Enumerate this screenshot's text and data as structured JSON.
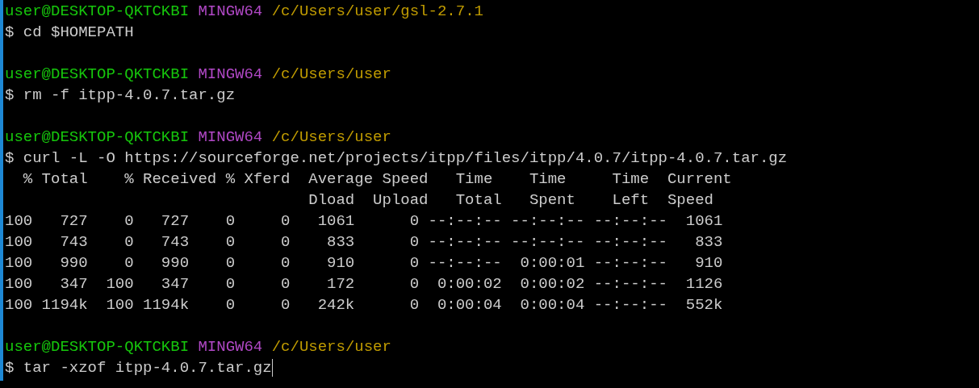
{
  "lines": [
    {
      "kind": "prompt",
      "user_host": "user@DESKTOP-QKTCKBI",
      "shell": "MINGW64",
      "path": "/c/Users/user/gsl-2.7.1"
    },
    {
      "kind": "command",
      "text": "$ cd $HOMEPATH",
      "cursor": false
    },
    {
      "kind": "blank"
    },
    {
      "kind": "prompt",
      "user_host": "user@DESKTOP-QKTCKBI",
      "shell": "MINGW64",
      "path": "/c/Users/user"
    },
    {
      "kind": "command",
      "text": "$ rm -f itpp-4.0.7.tar.gz",
      "cursor": false
    },
    {
      "kind": "blank"
    },
    {
      "kind": "prompt",
      "user_host": "user@DESKTOP-QKTCKBI",
      "shell": "MINGW64",
      "path": "/c/Users/user"
    },
    {
      "kind": "command",
      "text": "$ curl -L -O https://sourceforge.net/projects/itpp/files/itpp/4.0.7/itpp-4.0.7.tar.gz",
      "cursor": false
    },
    {
      "kind": "output",
      "text": "  % Total    % Received % Xferd  Average Speed   Time    Time     Time  Current"
    },
    {
      "kind": "output",
      "text": "                                 Dload  Upload   Total   Spent    Left  Speed"
    },
    {
      "kind": "output",
      "text": "100   727    0   727    0     0   1061      0 --:--:-- --:--:-- --:--:--  1061"
    },
    {
      "kind": "output",
      "text": "100   743    0   743    0     0    833      0 --:--:-- --:--:-- --:--:--   833"
    },
    {
      "kind": "output",
      "text": "100   990    0   990    0     0    910      0 --:--:--  0:00:01 --:--:--   910"
    },
    {
      "kind": "output",
      "text": "100   347  100   347    0     0    172      0  0:00:02  0:00:02 --:--:--  1126"
    },
    {
      "kind": "output",
      "text": "100 1194k  100 1194k    0     0   242k      0  0:00:04  0:00:04 --:--:--  552k"
    },
    {
      "kind": "blank"
    },
    {
      "kind": "prompt",
      "user_host": "user@DESKTOP-QKTCKBI",
      "shell": "MINGW64",
      "path": "/c/Users/user"
    },
    {
      "kind": "command",
      "text": "$ tar -xzof itpp-4.0.7.tar.gz",
      "cursor": true
    }
  ]
}
